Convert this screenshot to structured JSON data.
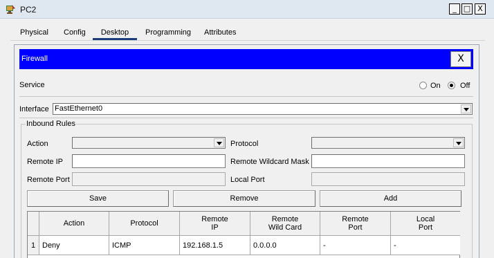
{
  "window": {
    "title": "PC2",
    "minimize": "_",
    "maximize": "□",
    "close": "X"
  },
  "tabs": [
    {
      "label": "Physical",
      "active": false
    },
    {
      "label": "Config",
      "active": false
    },
    {
      "label": "Desktop",
      "active": true
    },
    {
      "label": "Programming",
      "active": false
    },
    {
      "label": "Attributes",
      "active": false
    }
  ],
  "firewall": {
    "title": "Firewall",
    "close": "X",
    "header_color": "#0000ff"
  },
  "service": {
    "label": "Service",
    "on_label": "On",
    "off_label": "Off",
    "selected": "Off"
  },
  "interface": {
    "label": "Interface",
    "value": "FastEthernet0"
  },
  "inbound": {
    "title": "Inbound Rules",
    "action_label": "Action",
    "action_value": "",
    "protocol_label": "Protocol",
    "protocol_value": "",
    "remote_ip_label": "Remote IP",
    "remote_ip_value": "",
    "remote_wildcard_label": "Remote Wildcard Mask",
    "remote_wildcard_value": "",
    "remote_port_label": "Remote Port",
    "remote_port_value": "",
    "local_port_label": "Local Port",
    "local_port_value": ""
  },
  "buttons": {
    "save": "Save",
    "remove": "Remove",
    "add": "Add"
  },
  "table": {
    "columns": [
      "",
      "Action",
      "Protocol",
      "Remote\nIP",
      "Remote\nWild Card",
      "Remote\nPort",
      "Local\nPort"
    ],
    "rows": [
      [
        "1",
        "Deny",
        "ICMP",
        "192.168.1.5",
        "0.0.0.0",
        "-",
        "-"
      ]
    ]
  }
}
